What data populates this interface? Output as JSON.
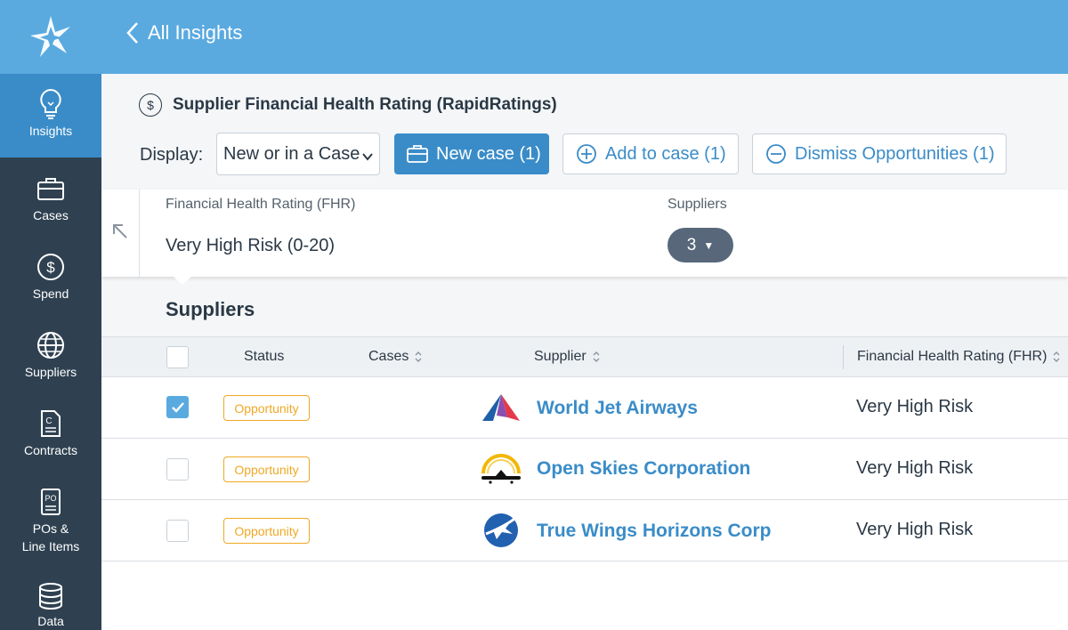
{
  "header": {
    "back_label": "All Insights"
  },
  "sidebar": {
    "items": [
      {
        "label": "Insights",
        "icon": "lightbulb-icon",
        "active": true
      },
      {
        "label": "Cases",
        "icon": "briefcase-icon"
      },
      {
        "label": "Spend",
        "icon": "dollar-icon"
      },
      {
        "label": "Suppliers",
        "icon": "globe-icon"
      },
      {
        "label": "Contracts",
        "icon": "contract-icon"
      },
      {
        "label": "POs &\nLine Items",
        "icon": "po-icon"
      },
      {
        "label": "Data",
        "icon": "database-icon"
      }
    ]
  },
  "page": {
    "title": "Supplier Financial Health Rating (RapidRatings)",
    "display_label": "Display:",
    "display_value": "New or in a Case",
    "new_case_label": "New case (1)",
    "add_to_case_label": "Add to case (1)",
    "dismiss_label": "Dismiss Opportunities (1)"
  },
  "filter": {
    "fhr_label": "Financial Health Rating (FHR)",
    "fhr_value": "Very High Risk (0-20)",
    "suppliers_label": "Suppliers",
    "suppliers_count": "3"
  },
  "suppliers_heading": "Suppliers",
  "table": {
    "columns": {
      "status": "Status",
      "cases": "Cases",
      "supplier": "Supplier",
      "fhr": "Financial Health Rating (FHR)"
    },
    "rows": [
      {
        "checked": true,
        "status": "Opportunity",
        "supplier": "World Jet Airways",
        "fhr": "Very High Risk"
      },
      {
        "checked": false,
        "status": "Opportunity",
        "supplier": "Open Skies Corporation",
        "fhr": "Very High Risk"
      },
      {
        "checked": false,
        "status": "Opportunity",
        "supplier": "True Wings Horizons Corp",
        "fhr": "Very High Risk"
      }
    ]
  },
  "colors": {
    "header_blue": "#5aaae0",
    "primary": "#3a8cc8",
    "sidebar": "#2f4151",
    "badge_orange": "#f0a825"
  }
}
